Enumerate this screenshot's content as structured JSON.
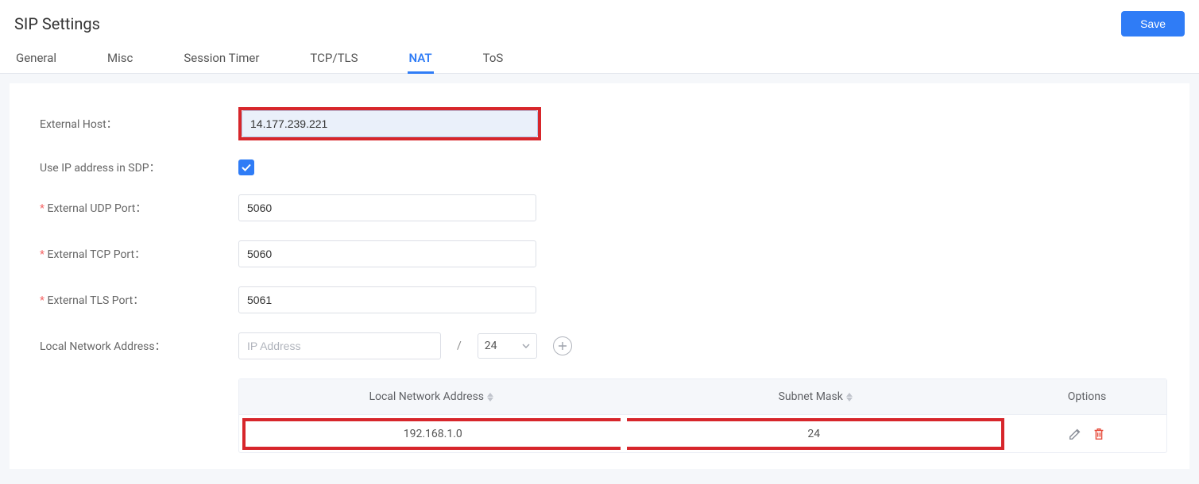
{
  "page": {
    "title": "SIP Settings",
    "save_label": "Save"
  },
  "tabs": [
    {
      "label": "General",
      "active": false
    },
    {
      "label": "Misc",
      "active": false
    },
    {
      "label": "Session Timer",
      "active": false
    },
    {
      "label": "TCP/TLS",
      "active": false
    },
    {
      "label": "NAT",
      "active": true
    },
    {
      "label": "ToS",
      "active": false
    }
  ],
  "form": {
    "external_host": {
      "label": "External Host：",
      "value": "14.177.239.221"
    },
    "use_ip_sdp": {
      "label": "Use IP address in SDP：",
      "checked": true
    },
    "ext_udp": {
      "label": "External UDP Port：",
      "value": "5060"
    },
    "ext_tcp": {
      "label": "External TCP Port：",
      "value": "5060"
    },
    "ext_tls": {
      "label": "External TLS Port：",
      "value": "5061"
    },
    "local_net": {
      "label": "Local Network Address：",
      "placeholder": "IP Address",
      "slash": "/",
      "subnet": "24"
    }
  },
  "table": {
    "headers": {
      "addr": "Local Network Address",
      "mask": "Subnet Mask",
      "opts": "Options"
    },
    "rows": [
      {
        "addr": "192.168.1.0",
        "mask": "24"
      }
    ]
  }
}
